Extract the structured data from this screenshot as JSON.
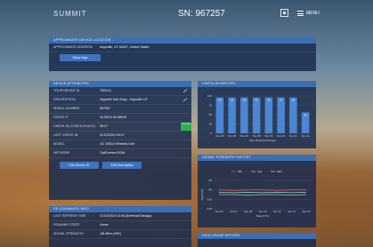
{
  "topbar": {
    "logo": "SUMMIT",
    "serial": "SN: 967257",
    "menu_label": "MENU"
  },
  "location": {
    "title": "APPROXIMATE DEVICE LOCATION",
    "address_label": "APPROXIMATE ADDRESS",
    "address_value": "Kaysville, UT 84037, United States",
    "show_map": "Show Map"
  },
  "attributes": {
    "title": "DEVICE ATTRIBUTES",
    "rows": [
      {
        "k": "YOUR DEVICE ID",
        "v": "T0B124"
      },
      {
        "k": "DESCRIPTION",
        "v": "Zeppelin Sub Shop - Kaysville UT"
      },
      {
        "k": "SERIAL NUMBER",
        "v": "967257"
      },
      {
        "k": "STATIC IP",
        "v": "10.000.0.00.98245"
      },
      {
        "k": "CHECK-IN (CHECK-IN AGO)",
        "v": "06:27",
        "badge": "8.5 min"
      },
      {
        "k": "LAST CHECK-IN",
        "v": "11/12/2019 03:17"
      },
      {
        "k": "MODEL",
        "v": "OC 1052A Wireless Unit"
      },
      {
        "k": "NETWORK",
        "v": "OptConnect BOM"
      }
    ],
    "btn_edit_device": "Edit Device ID",
    "btn_edit_description": "Edit Description"
  },
  "summary": {
    "title": "OS (SUMMARY) INFO",
    "rows": [
      {
        "k": "LAST REFRESH TIME",
        "v": "11/12/2019 13:46 (America/Chicago)"
      },
      {
        "k": "ROAMING STATE",
        "v": "Home"
      },
      {
        "k": "SIGNAL STRENGTH",
        "v": "-86 dBm (49%)"
      }
    ]
  },
  "checkin_chart": {
    "title": "CHECK-IN HISTORY",
    "y_ticks": [
      "100",
      "75",
      "50",
      "25",
      "0"
    ],
    "x_title": "Date (America/Chicago)"
  },
  "signal_chart": {
    "title": "SIGNAL STRENGTH HISTORY",
    "legend": [
      "Min",
      "Avg",
      "Max"
    ],
    "y_ticks": [
      "-60",
      "-80",
      "-100",
      "-120"
    ],
    "y_title": "Signal (%)",
    "x_title": "Date (UTC)"
  },
  "data_usage": {
    "title": "DATA USAGE HISTORY"
  },
  "chart_data": [
    {
      "type": "bar",
      "categories": [
        "Nov 05",
        "Nov 06",
        "Nov 07",
        "Nov 08",
        "Nov 09",
        "Nov 10",
        "Nov 11",
        "Nov 12"
      ],
      "values": [
        96,
        96,
        96,
        96,
        96,
        96,
        96,
        56
      ],
      "data_labels": [
        "96",
        "96",
        "96",
        "96",
        "96",
        "96",
        "96",
        "56"
      ],
      "title": "CHECK-IN HISTORY",
      "xlabel": "Date (America/Chicago)",
      "ylabel": "",
      "ylim": [
        0,
        100
      ],
      "color": "#4a86d4"
    },
    {
      "type": "line",
      "categories": [
        "Nov 06",
        "Nov 07",
        "Nov 08",
        "Nov 09",
        "Nov 10",
        "Nov 11",
        "Nov 12"
      ],
      "series": [
        {
          "name": "Min",
          "values": [
            -80,
            -81,
            -80,
            -80,
            -81,
            -80,
            -80
          ],
          "color": "#e25563"
        },
        {
          "name": "Avg",
          "values": [
            -85,
            -86,
            -85,
            -86,
            -85,
            -86,
            -85
          ],
          "color": "#8fd1c2"
        },
        {
          "name": "Max",
          "values": [
            -90,
            -90,
            -91,
            -90,
            -90,
            -91,
            -90
          ],
          "color": "#a9b8d6"
        }
      ],
      "title": "SIGNAL STRENGTH HISTORY",
      "xlabel": "Date (UTC)",
      "ylabel": "Signal (%)",
      "ylim": [
        -120,
        -60
      ]
    }
  ]
}
